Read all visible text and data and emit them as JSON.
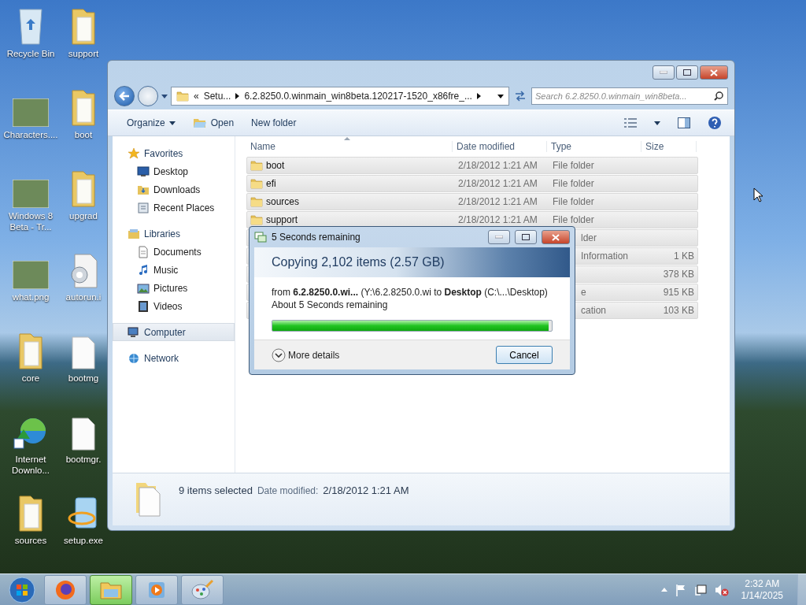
{
  "desktop_icons": [
    {
      "label": "Recycle Bin",
      "kind": "recycle"
    },
    {
      "label": "support",
      "kind": "folder"
    },
    {
      "label": "Characters....",
      "kind": "photo"
    },
    {
      "label": "boot",
      "kind": "folder"
    },
    {
      "label": "Windows 8 Beta - Tr...",
      "kind": "photo"
    },
    {
      "label": "upgrad",
      "kind": "folder"
    },
    {
      "label": "what.png",
      "kind": "photo"
    },
    {
      "label": "autorun.i",
      "kind": "settings"
    },
    {
      "label": "core",
      "kind": "folder"
    },
    {
      "label": "bootmg",
      "kind": "document"
    },
    {
      "label": "Internet Downlo...",
      "kind": "download"
    },
    {
      "label": "bootmgr.",
      "kind": "document"
    },
    {
      "label": "sources",
      "kind": "folder"
    },
    {
      "label": "setup.exe",
      "kind": "setup"
    }
  ],
  "explorer": {
    "address": {
      "overflow": "«",
      "crumbs": [
        "Setu...",
        "6.2.8250.0.winmain_win8beta.120217-1520_x86fre_..."
      ]
    },
    "search": {
      "placeholder": "Search 6.2.8250.0.winmain_win8beta..."
    },
    "toolbar": [
      {
        "label": "Organize",
        "kind": "menu"
      },
      {
        "label": "Open",
        "kind": "open"
      },
      {
        "label": "New folder",
        "kind": "plain"
      }
    ],
    "nav": [
      {
        "label": "Favorites",
        "kind": "star",
        "selected": false,
        "children": [
          {
            "label": "Desktop",
            "kind": "desktop",
            "selected": false
          },
          {
            "label": "Downloads",
            "kind": "downloads",
            "selected": false
          },
          {
            "label": "Recent Places",
            "kind": "recent",
            "selected": false
          }
        ]
      },
      {
        "label": "Libraries",
        "kind": "library",
        "selected": false,
        "children": [
          {
            "label": "Documents",
            "kind": "documents",
            "selected": false
          },
          {
            "label": "Music",
            "kind": "music",
            "selected": false
          },
          {
            "label": "Pictures",
            "kind": "pictures",
            "selected": false
          },
          {
            "label": "Videos",
            "kind": "videos",
            "selected": false
          }
        ]
      },
      {
        "label": "Computer",
        "kind": "computer",
        "selected": true
      },
      {
        "label": "Network",
        "kind": "network",
        "selected": false
      }
    ],
    "columns": [
      "Name",
      "Date modified",
      "Type",
      "Size"
    ],
    "rows": [
      {
        "kind": "full",
        "selected": true,
        "name": "boot",
        "date": "2/18/2012 1:21 AM",
        "type": "File folder"
      },
      {
        "kind": "full",
        "selected": true,
        "name": "efi",
        "date": "2/18/2012 1:21 AM",
        "type": "File folder"
      },
      {
        "kind": "full",
        "selected": true,
        "name": "sources",
        "date": "2/18/2012 1:21 AM",
        "type": "File folder"
      },
      {
        "kind": "full",
        "selected": true,
        "name": "support",
        "date": "2/18/2012 1:21 AM",
        "type": "File folder"
      },
      {
        "kind": "covered",
        "selected": true,
        "type": "lder"
      },
      {
        "kind": "covered",
        "selected": true,
        "type": "Information",
        "size": "1 KB"
      },
      {
        "kind": "covered",
        "selected": true,
        "size": "378 KB"
      },
      {
        "kind": "covered",
        "selected": true,
        "type": "e",
        "size": "915 KB"
      },
      {
        "kind": "covered",
        "selected": true,
        "type": "cation",
        "size": "103 KB"
      }
    ],
    "status": {
      "selection": "9 items selected",
      "date_label": "Date modified:",
      "date": "2/18/2012 1:21 AM"
    }
  },
  "dialog": {
    "title": "5 Seconds remaining",
    "heading": "Copying 2,102 items (2.57 GB)",
    "route": "from **6.2.8250.0.wi...** (Y:\\6.2.8250.0.wi to **Desktop** (C:\\...\\Desktop)",
    "remaining": "About 5 Seconds remaining",
    "level": 0.99,
    "details": "More details",
    "cancel": "Cancel"
  },
  "taskbar": {
    "apps": [
      {
        "kind": "firefox",
        "selected": false
      },
      {
        "kind": "explorer",
        "selected": true
      },
      {
        "kind": "media",
        "selected": false
      },
      {
        "kind": "paint",
        "selected": false
      }
    ],
    "time": "2:32 AM",
    "date": "1/14/2025"
  }
}
